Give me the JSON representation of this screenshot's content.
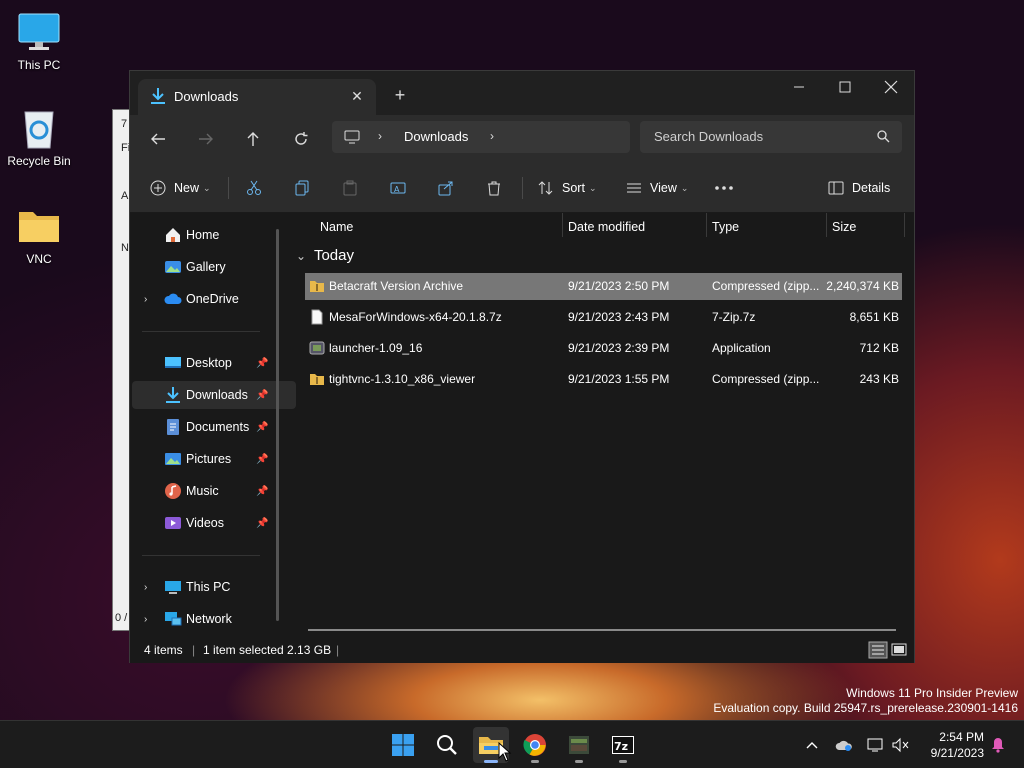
{
  "desktop": {
    "icons": [
      {
        "label": "This PC"
      },
      {
        "label": "Recycle Bin"
      },
      {
        "label": "VNC"
      }
    ]
  },
  "back_window": {
    "labels": [
      "7",
      "Fi",
      "A",
      "N",
      "0 /"
    ]
  },
  "explorer": {
    "tab_title": "Downloads",
    "address": {
      "crumb": "Downloads"
    },
    "search": {
      "placeholder": "Search Downloads"
    },
    "commands": {
      "new": "New",
      "sort": "Sort",
      "view": "View",
      "details": "Details"
    },
    "sidebar": {
      "quick": [
        {
          "label": "Home",
          "icon": "home-icon"
        },
        {
          "label": "Gallery",
          "icon": "gallery-icon"
        },
        {
          "label": "OneDrive",
          "icon": "cloud-icon"
        }
      ],
      "pinned": [
        {
          "label": "Desktop",
          "icon": "desktop-icon"
        },
        {
          "label": "Downloads",
          "icon": "download-icon",
          "selected": true
        },
        {
          "label": "Documents",
          "icon": "documents-icon"
        },
        {
          "label": "Pictures",
          "icon": "pictures-icon"
        },
        {
          "label": "Music",
          "icon": "music-icon"
        },
        {
          "label": "Videos",
          "icon": "videos-icon"
        }
      ],
      "locations": [
        {
          "label": "This PC",
          "icon": "pc-icon"
        },
        {
          "label": "Network",
          "icon": "network-icon"
        }
      ]
    },
    "columns": {
      "name": "Name",
      "date": "Date modified",
      "type": "Type",
      "size": "Size"
    },
    "group": "Today",
    "files": [
      {
        "name": "Betacraft Version Archive",
        "date": "9/21/2023 2:50 PM",
        "type": "Compressed (zipp...",
        "size": "2,240,374 KB",
        "selected": true,
        "icon": "zip-folder-icon"
      },
      {
        "name": "MesaForWindows-x64-20.1.8.7z",
        "date": "9/21/2023 2:43 PM",
        "type": "7-Zip.7z",
        "size": "8,651 KB",
        "selected": false,
        "icon": "file-icon"
      },
      {
        "name": "launcher-1.09_16",
        "date": "9/21/2023 2:39 PM",
        "type": "Application",
        "size": "712 KB",
        "selected": false,
        "icon": "app-icon"
      },
      {
        "name": "tightvnc-1.3.10_x86_viewer",
        "date": "9/21/2023 1:55 PM",
        "type": "Compressed (zipp...",
        "size": "243 KB",
        "selected": false,
        "icon": "zip-folder-icon"
      }
    ],
    "status": {
      "count": "4 items",
      "selection": "1 item selected  2.13 GB"
    }
  },
  "watermark": {
    "line1": "Windows 11 Pro Insider Preview",
    "line2": "Evaluation copy. Build 25947.rs_prerelease.230901-1416"
  },
  "taskbar": {
    "time": "2:54 PM",
    "date": "9/21/2023"
  },
  "colors": {
    "accent": "#4cc2ff",
    "selection": "#777777",
    "folder": "#e8b84a"
  }
}
